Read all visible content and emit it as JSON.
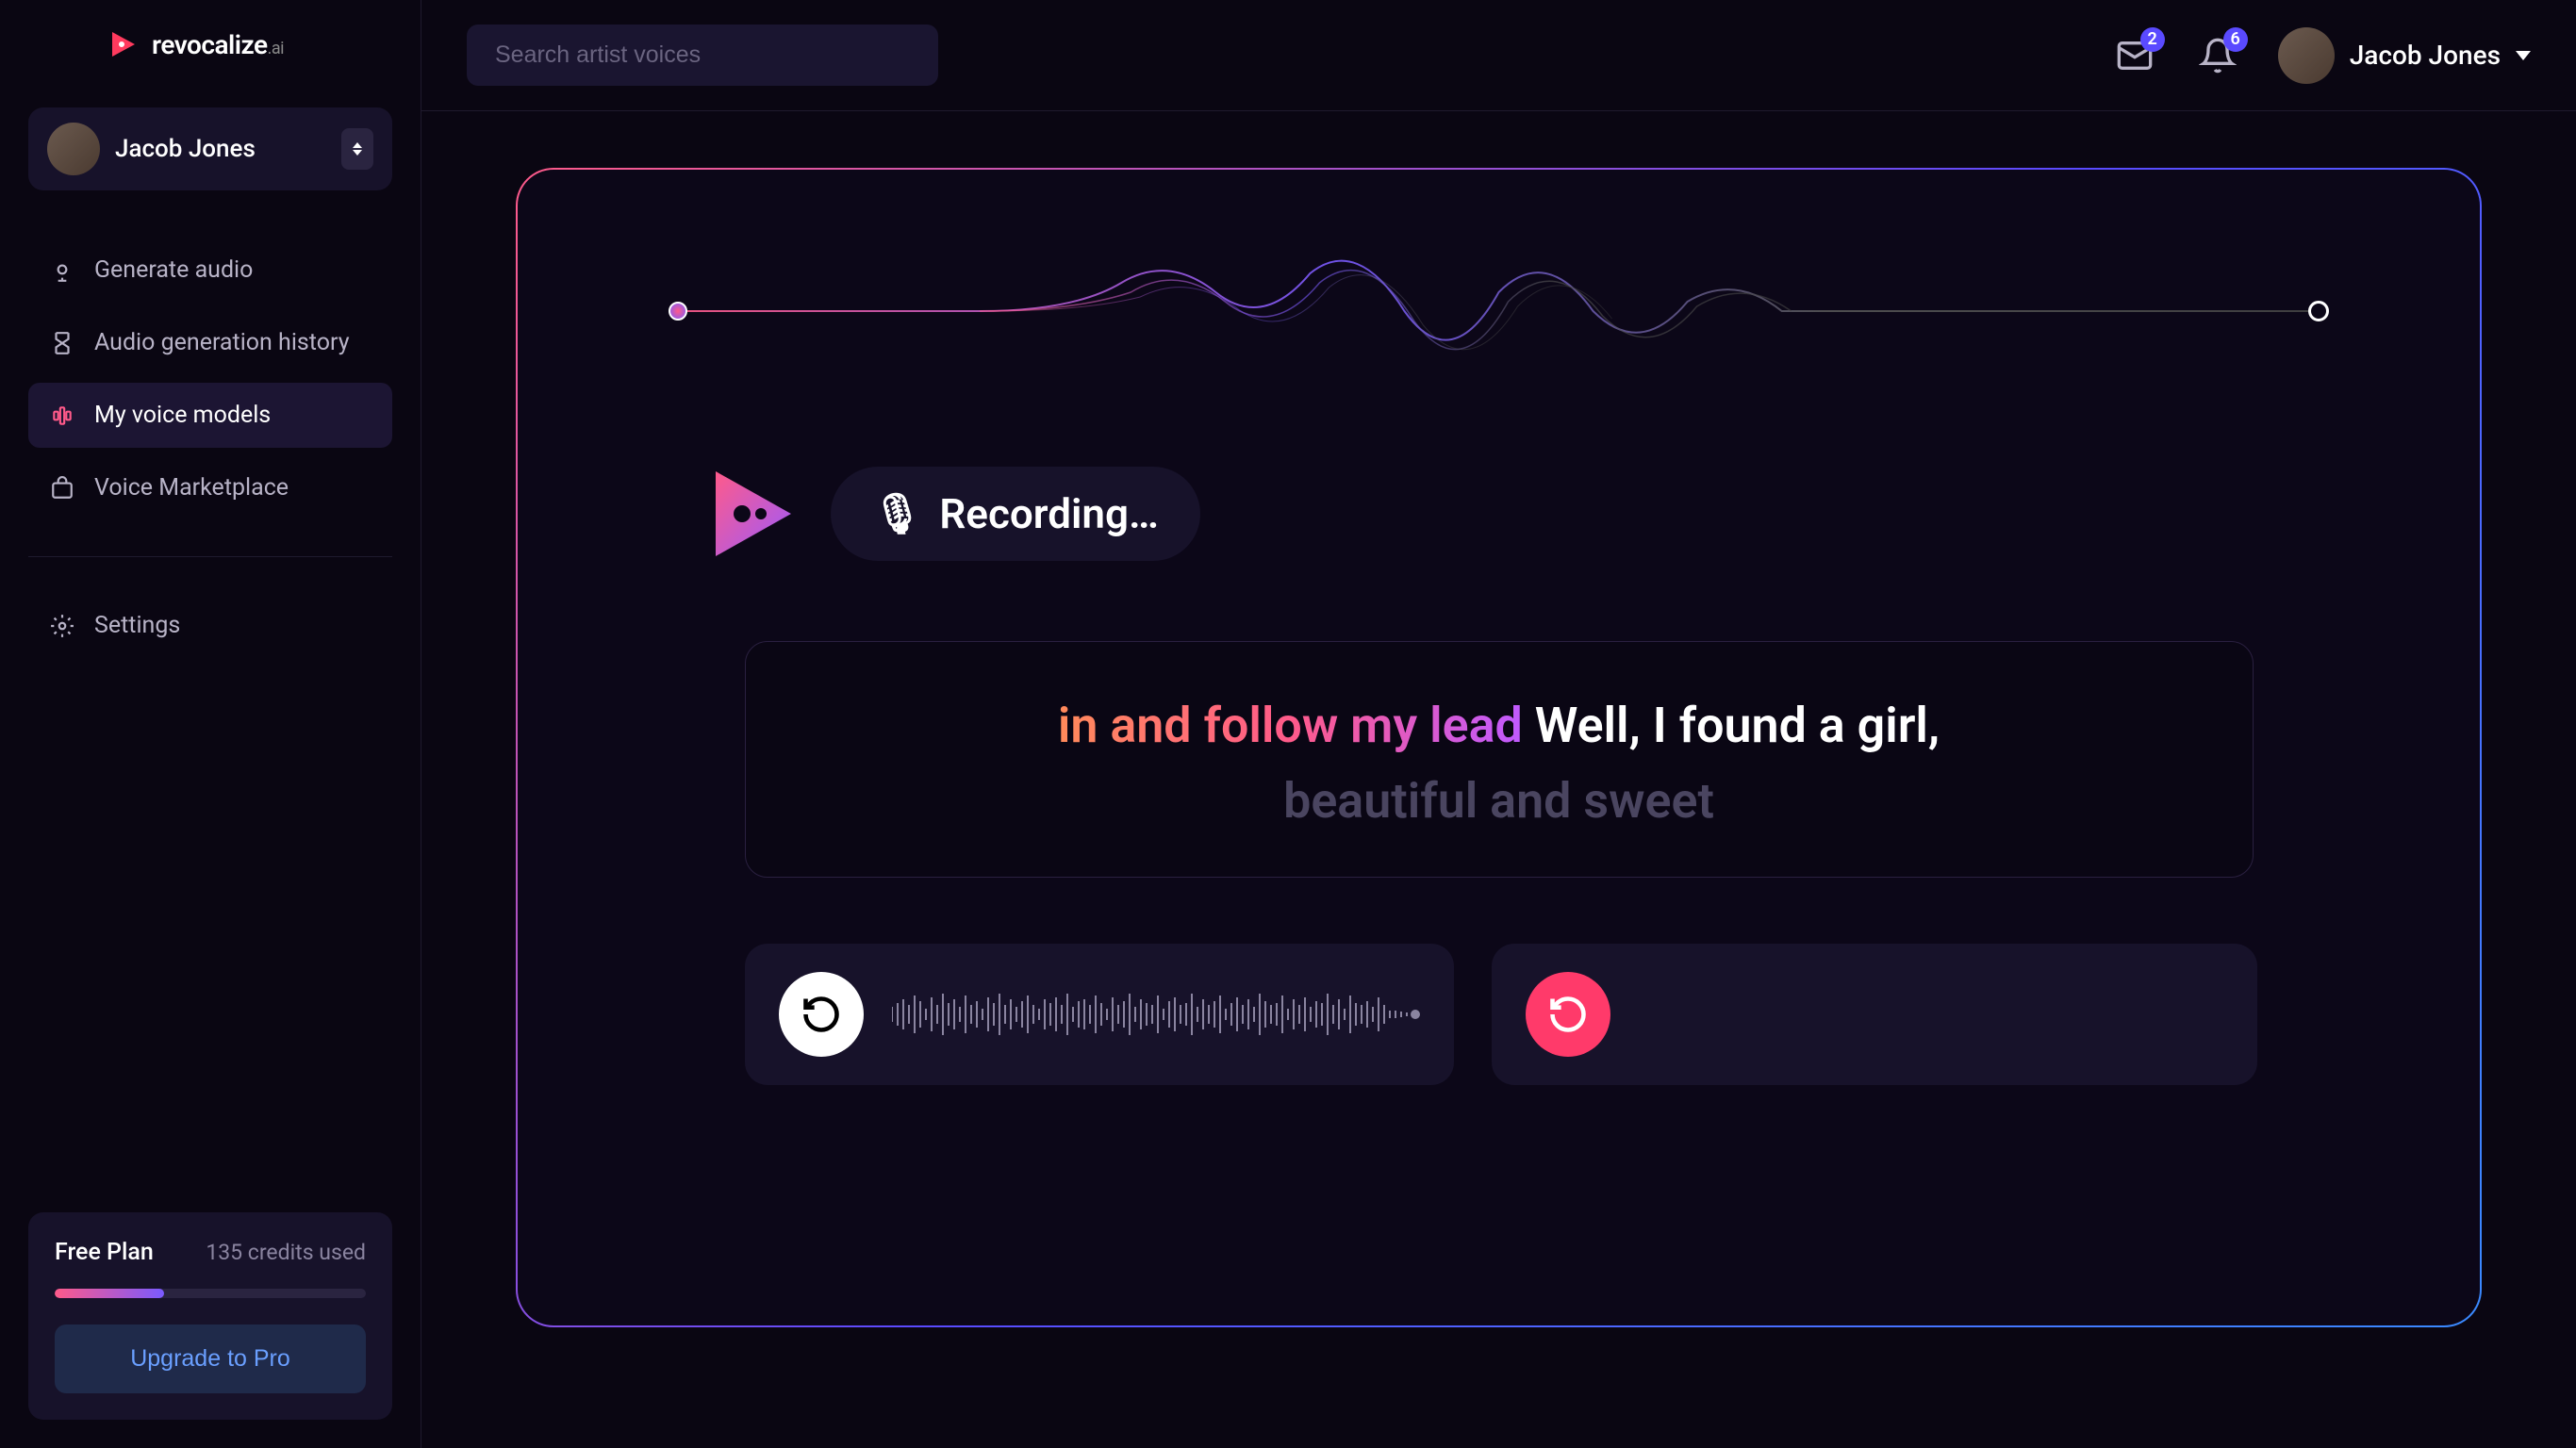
{
  "brand": {
    "name": "revocalize",
    "suffix": ".ai"
  },
  "user": {
    "name": "Jacob Jones"
  },
  "search": {
    "placeholder": "Search artist voices"
  },
  "notifications": {
    "mail_count": "2",
    "bell_count": "6"
  },
  "sidebar": {
    "items": [
      {
        "label": "Generate audio",
        "icon": "mic-icon"
      },
      {
        "label": "Audio generation history",
        "icon": "hourglass-icon"
      },
      {
        "label": "My voice models",
        "icon": "voice-icon",
        "active": true
      },
      {
        "label": "Voice Marketplace",
        "icon": "shop-icon"
      }
    ],
    "settings_label": "Settings"
  },
  "plan": {
    "name": "Free Plan",
    "credits": "135 credits used",
    "progress_percent": 35,
    "upgrade_label": "Upgrade to Pro"
  },
  "recording": {
    "status": "Recording…",
    "lyrics_highlight": "in and follow my lead",
    "lyrics_rest": " Well, I found a girl,",
    "lyrics_next": "beautiful and sweet"
  },
  "colors": {
    "accent_pink": "#ff3a6a",
    "accent_purple": "#7a5aff",
    "bg": "#0a0612"
  }
}
